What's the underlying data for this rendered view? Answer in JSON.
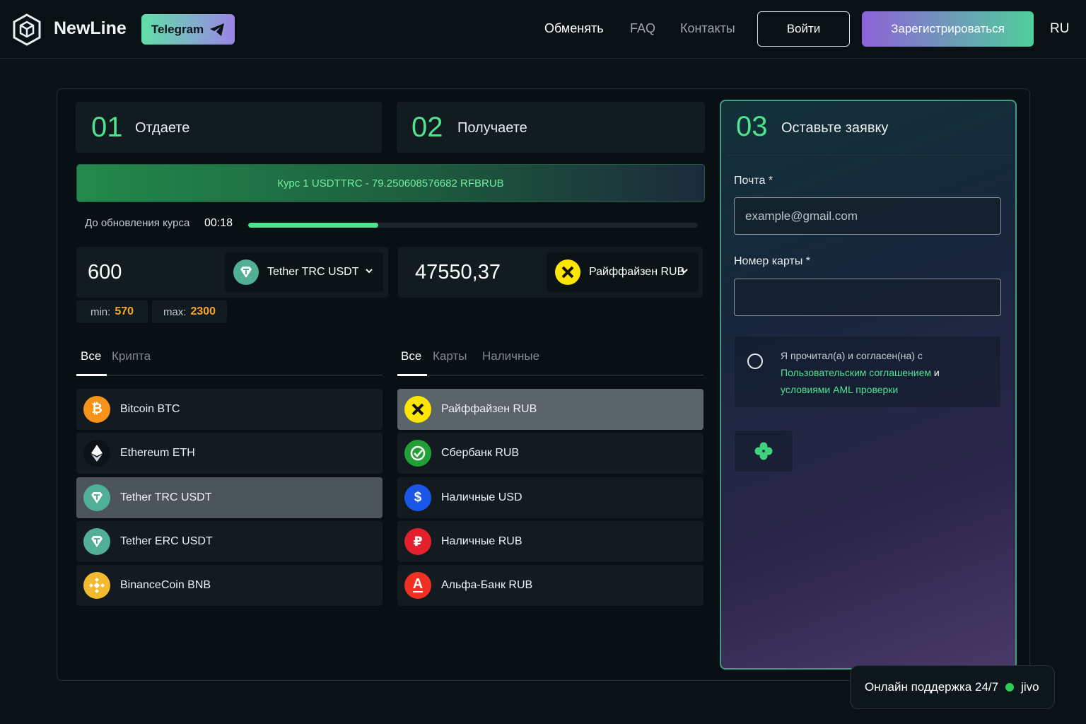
{
  "header": {
    "brand": "NewLine",
    "telegram_label": "Telegram",
    "nav": [
      "Обменять",
      "FAQ",
      "Контакты"
    ],
    "login_label": "Войти",
    "register_label": "Зарегистрироваться",
    "lang": "RU"
  },
  "steps": {
    "give": {
      "num": "01",
      "title": "Отдаете"
    },
    "get": {
      "num": "02",
      "title": "Получаете"
    },
    "request": {
      "num": "03",
      "title": "Оставьте заявку"
    }
  },
  "rate": {
    "text": "Курс 1 USDTTRC - 79.250608576682 RFBRUB",
    "refresh_label": "До обновления курса",
    "refresh_time": "00:18",
    "refresh_progress": 0.29
  },
  "give": {
    "amount": "600",
    "currency": "Tether TRC USDT",
    "min_label": "min:",
    "min_value": "570",
    "max_label": "max:",
    "max_value": "2300",
    "tabs": [
      "Все",
      "Крипта"
    ],
    "items": [
      {
        "label": "Bitcoin BTC",
        "icon": "bitcoin-icon",
        "color": "#f7931a"
      },
      {
        "label": "Ethereum ETH",
        "icon": "ethereum-icon",
        "color": "#0d1216"
      },
      {
        "label": "Tether TRC USDT",
        "icon": "tether-icon",
        "color": "#50af95",
        "selected": true
      },
      {
        "label": "Tether ERC USDT",
        "icon": "tether-icon",
        "color": "#50af95"
      },
      {
        "label": "BinanceCoin BNB",
        "icon": "binance-icon",
        "color": "#f3ba2f"
      }
    ]
  },
  "get": {
    "amount": "47550,37",
    "currency": "Райффайзен RUB",
    "tabs": [
      "Все",
      "Карты",
      "Наличные"
    ],
    "items": [
      {
        "label": "Райффайзен RUB",
        "icon": "raiffeisen-icon",
        "color": "#fee600",
        "selected": true
      },
      {
        "label": "Сбербанк RUB",
        "icon": "sberbank-icon",
        "color": "#21a038"
      },
      {
        "label": "Наличные USD",
        "icon": "dollar-icon",
        "color": "#1a56e8"
      },
      {
        "label": "Наличные RUB",
        "icon": "ruble-icon",
        "color": "#e4202c"
      },
      {
        "label": "Альфа-Банк RUB",
        "icon": "alfabank-icon",
        "color": "#ef3124"
      }
    ]
  },
  "form": {
    "email_label": "Почта *",
    "email_placeholder": "example@gmail.com",
    "card_label": "Номер карты *",
    "card_value": "",
    "agree_prefix": "Я прочитал(а) и согласен(на) с",
    "agree_link1": "Пользовательским соглашением",
    "agree_and": " и",
    "agree_link2": "условиями AML проверки"
  },
  "support": {
    "text": "Онлайн поддержка 24/7",
    "brand": "jivo"
  }
}
